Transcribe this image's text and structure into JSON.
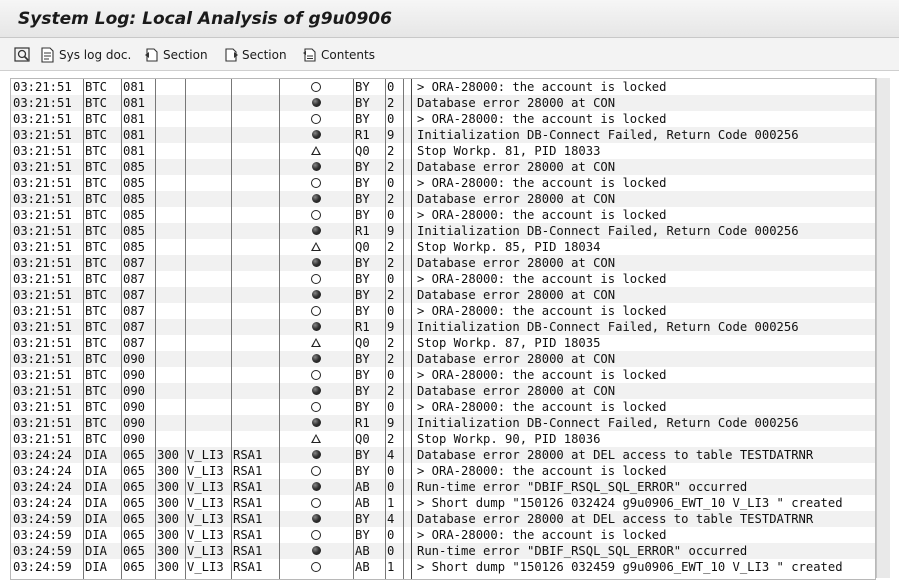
{
  "window": {
    "title": "System Log: Local Analysis of g9u0906"
  },
  "toolbar": {
    "items": [
      {
        "label": "",
        "icon": "zoom-icon"
      },
      {
        "label": "Sys log doc.",
        "icon": "document-icon"
      },
      {
        "label": "Section",
        "icon": "section-icon"
      },
      {
        "label": "Section",
        "icon": "section-icon"
      },
      {
        "label": "Contents",
        "icon": "contents-icon"
      }
    ]
  },
  "log": {
    "rows": [
      {
        "time": "03:21:51",
        "task": "BTC",
        "wp": "081",
        "client": "",
        "user": "",
        "tcode": "",
        "priority": "circle",
        "msg": "BY",
        "cat": "0",
        "text": "> ORA-28000: the account is locked"
      },
      {
        "time": "03:21:51",
        "task": "BTC",
        "wp": "081",
        "client": "",
        "user": "",
        "tcode": "",
        "priority": "dot",
        "msg": "BY",
        "cat": "2",
        "text": "Database error 28000 at CON"
      },
      {
        "time": "03:21:51",
        "task": "BTC",
        "wp": "081",
        "client": "",
        "user": "",
        "tcode": "",
        "priority": "circle",
        "msg": "BY",
        "cat": "0",
        "text": "> ORA-28000: the account is locked"
      },
      {
        "time": "03:21:51",
        "task": "BTC",
        "wp": "081",
        "client": "",
        "user": "",
        "tcode": "",
        "priority": "dot",
        "msg": "R1",
        "cat": "9",
        "text": "Initialization DB-Connect Failed, Return Code 000256"
      },
      {
        "time": "03:21:51",
        "task": "BTC",
        "wp": "081",
        "client": "",
        "user": "",
        "tcode": "",
        "priority": "triangle",
        "msg": "Q0",
        "cat": "2",
        "text": "Stop Workp. 81, PID 18033"
      },
      {
        "time": "03:21:51",
        "task": "BTC",
        "wp": "085",
        "client": "",
        "user": "",
        "tcode": "",
        "priority": "dot",
        "msg": "BY",
        "cat": "2",
        "text": "Database error 28000 at CON"
      },
      {
        "time": "03:21:51",
        "task": "BTC",
        "wp": "085",
        "client": "",
        "user": "",
        "tcode": "",
        "priority": "circle",
        "msg": "BY",
        "cat": "0",
        "text": "> ORA-28000: the account is locked"
      },
      {
        "time": "03:21:51",
        "task": "BTC",
        "wp": "085",
        "client": "",
        "user": "",
        "tcode": "",
        "priority": "dot",
        "msg": "BY",
        "cat": "2",
        "text": "Database error 28000 at CON"
      },
      {
        "time": "03:21:51",
        "task": "BTC",
        "wp": "085",
        "client": "",
        "user": "",
        "tcode": "",
        "priority": "circle",
        "msg": "BY",
        "cat": "0",
        "text": "> ORA-28000: the account is locked"
      },
      {
        "time": "03:21:51",
        "task": "BTC",
        "wp": "085",
        "client": "",
        "user": "",
        "tcode": "",
        "priority": "dot",
        "msg": "R1",
        "cat": "9",
        "text": "Initialization DB-Connect Failed, Return Code 000256"
      },
      {
        "time": "03:21:51",
        "task": "BTC",
        "wp": "085",
        "client": "",
        "user": "",
        "tcode": "",
        "priority": "triangle",
        "msg": "Q0",
        "cat": "2",
        "text": "Stop Workp. 85, PID 18034"
      },
      {
        "time": "03:21:51",
        "task": "BTC",
        "wp": "087",
        "client": "",
        "user": "",
        "tcode": "",
        "priority": "dot",
        "msg": "BY",
        "cat": "2",
        "text": "Database error 28000 at CON"
      },
      {
        "time": "03:21:51",
        "task": "BTC",
        "wp": "087",
        "client": "",
        "user": "",
        "tcode": "",
        "priority": "circle",
        "msg": "BY",
        "cat": "0",
        "text": "> ORA-28000: the account is locked"
      },
      {
        "time": "03:21:51",
        "task": "BTC",
        "wp": "087",
        "client": "",
        "user": "",
        "tcode": "",
        "priority": "dot",
        "msg": "BY",
        "cat": "2",
        "text": "Database error 28000 at CON"
      },
      {
        "time": "03:21:51",
        "task": "BTC",
        "wp": "087",
        "client": "",
        "user": "",
        "tcode": "",
        "priority": "circle",
        "msg": "BY",
        "cat": "0",
        "text": "> ORA-28000: the account is locked"
      },
      {
        "time": "03:21:51",
        "task": "BTC",
        "wp": "087",
        "client": "",
        "user": "",
        "tcode": "",
        "priority": "dot",
        "msg": "R1",
        "cat": "9",
        "text": "Initialization DB-Connect Failed, Return Code 000256"
      },
      {
        "time": "03:21:51",
        "task": "BTC",
        "wp": "087",
        "client": "",
        "user": "",
        "tcode": "",
        "priority": "triangle",
        "msg": "Q0",
        "cat": "2",
        "text": "Stop Workp. 87, PID 18035"
      },
      {
        "time": "03:21:51",
        "task": "BTC",
        "wp": "090",
        "client": "",
        "user": "",
        "tcode": "",
        "priority": "dot",
        "msg": "BY",
        "cat": "2",
        "text": "Database error 28000 at CON"
      },
      {
        "time": "03:21:51",
        "task": "BTC",
        "wp": "090",
        "client": "",
        "user": "",
        "tcode": "",
        "priority": "circle",
        "msg": "BY",
        "cat": "0",
        "text": "> ORA-28000: the account is locked"
      },
      {
        "time": "03:21:51",
        "task": "BTC",
        "wp": "090",
        "client": "",
        "user": "",
        "tcode": "",
        "priority": "dot",
        "msg": "BY",
        "cat": "2",
        "text": "Database error 28000 at CON"
      },
      {
        "time": "03:21:51",
        "task": "BTC",
        "wp": "090",
        "client": "",
        "user": "",
        "tcode": "",
        "priority": "circle",
        "msg": "BY",
        "cat": "0",
        "text": "> ORA-28000: the account is locked"
      },
      {
        "time": "03:21:51",
        "task": "BTC",
        "wp": "090",
        "client": "",
        "user": "",
        "tcode": "",
        "priority": "dot",
        "msg": "R1",
        "cat": "9",
        "text": "Initialization DB-Connect Failed, Return Code 000256"
      },
      {
        "time": "03:21:51",
        "task": "BTC",
        "wp": "090",
        "client": "",
        "user": "",
        "tcode": "",
        "priority": "triangle",
        "msg": "Q0",
        "cat": "2",
        "text": "Stop Workp. 90, PID 18036"
      },
      {
        "time": "03:24:24",
        "task": "DIA",
        "wp": "065",
        "client": "300",
        "user": "V_LI3",
        "tcode": "RSA1",
        "priority": "dot",
        "msg": "BY",
        "cat": "4",
        "text": "Database error 28000 at DEL access to table TESTDATRNR"
      },
      {
        "time": "03:24:24",
        "task": "DIA",
        "wp": "065",
        "client": "300",
        "user": "V_LI3",
        "tcode": "RSA1",
        "priority": "circle",
        "msg": "BY",
        "cat": "0",
        "text": "> ORA-28000: the account is locked"
      },
      {
        "time": "03:24:24",
        "task": "DIA",
        "wp": "065",
        "client": "300",
        "user": "V_LI3",
        "tcode": "RSA1",
        "priority": "dot",
        "msg": "AB",
        "cat": "0",
        "text": "Run-time error \"DBIF_RSQL_SQL_ERROR\" occurred"
      },
      {
        "time": "03:24:24",
        "task": "DIA",
        "wp": "065",
        "client": "300",
        "user": "V_LI3",
        "tcode": "RSA1",
        "priority": "circle",
        "msg": "AB",
        "cat": "1",
        "text": "> Short dump \"150126 032424 g9u0906_EWT_10 V_LI3 \" created"
      },
      {
        "time": "03:24:59",
        "task": "DIA",
        "wp": "065",
        "client": "300",
        "user": "V_LI3",
        "tcode": "RSA1",
        "priority": "dot",
        "msg": "BY",
        "cat": "4",
        "text": "Database error 28000 at DEL access to table TESTDATRNR"
      },
      {
        "time": "03:24:59",
        "task": "DIA",
        "wp": "065",
        "client": "300",
        "user": "V_LI3",
        "tcode": "RSA1",
        "priority": "circle",
        "msg": "BY",
        "cat": "0",
        "text": "> ORA-28000: the account is locked"
      },
      {
        "time": "03:24:59",
        "task": "DIA",
        "wp": "065",
        "client": "300",
        "user": "V_LI3",
        "tcode": "RSA1",
        "priority": "dot",
        "msg": "AB",
        "cat": "0",
        "text": "Run-time error \"DBIF_RSQL_SQL_ERROR\" occurred"
      },
      {
        "time": "03:24:59",
        "task": "DIA",
        "wp": "065",
        "client": "300",
        "user": "V_LI3",
        "tcode": "RSA1",
        "priority": "circle",
        "msg": "AB",
        "cat": "1",
        "text": "> Short dump \"150126 032459 g9u0906_EWT_10 V_LI3 \" created"
      }
    ]
  }
}
